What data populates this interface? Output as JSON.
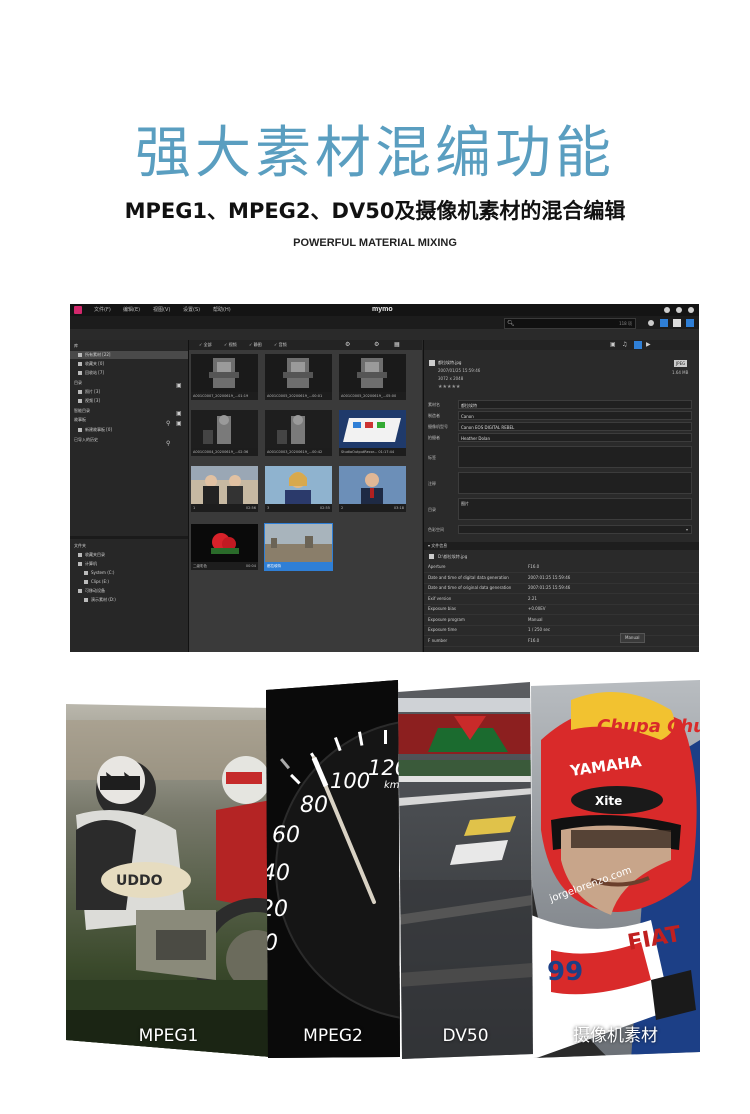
{
  "header": {
    "title": "强大素材混编功能",
    "subtitle": "MPEG1、MPEG2、DV50及摄像机素材的混合编辑",
    "tagline": "POWERFUL MATERIAL MIXING"
  },
  "app": {
    "name": "mymo",
    "menu": [
      "文件(F)",
      "编辑(E)",
      "视图(V)",
      "设置(S)",
      "帮助(H)"
    ],
    "search_count": "118 项",
    "left_tree": [
      {
        "label": "库",
        "sel": false
      },
      {
        "label": "所有素材 [22]",
        "sel": true
      },
      {
        "label": "收藏夹 [0]",
        "sel": false
      },
      {
        "label": "回收站 [7]",
        "sel": false
      },
      {
        "label": "目录",
        "sel": false
      },
      {
        "label": "照片 [3]",
        "sel": false
      },
      {
        "label": "视频 [3]",
        "sel": false
      },
      {
        "label": "智能目录",
        "sel": false
      },
      {
        "label": "故事板",
        "sel": false
      },
      {
        "label": "新建故事板 [0]",
        "sel": false
      },
      {
        "label": "已导入的历史",
        "sel": false
      }
    ],
    "folder_tree": [
      {
        "label": "文件夹"
      },
      {
        "label": "收藏夹目录"
      },
      {
        "label": "计算机"
      },
      {
        "label": "System (C:)"
      },
      {
        "label": "Clips (E:)"
      },
      {
        "label": "可移动设备"
      },
      {
        "label": "演示素材 (D:)"
      }
    ],
    "filters": [
      "全部",
      "视频",
      "静图",
      "音频"
    ],
    "thumbnails": [
      {
        "caption": "A001C0007_20200619_...01:19",
        "extra": "",
        "kind": "robot",
        "sel": false
      },
      {
        "caption": "A001C0005_20200619_...00:01",
        "extra": "",
        "kind": "robot",
        "sel": false
      },
      {
        "caption": "A001C0005_20200619_...05:00",
        "extra": "",
        "kind": "robot",
        "sel": false
      },
      {
        "caption": "A001C0004_20200619_...02:36",
        "extra": "",
        "kind": "robot2",
        "sel": false
      },
      {
        "caption": "A001C0003_20200619_...00:42",
        "extra": "",
        "kind": "robot2",
        "sel": false
      },
      {
        "caption": "StudioOutputRecor... 01:17:44",
        "extra": "",
        "kind": "board",
        "sel": false
      },
      {
        "caption": "1",
        "extra": "02:56",
        "kind": "people",
        "sel": false
      },
      {
        "caption": "3",
        "extra": "02:55",
        "kind": "woman",
        "sel": false
      },
      {
        "caption": "2",
        "extra": "03:18",
        "kind": "man",
        "sel": false
      },
      {
        "caption": "二级彩色",
        "extra": "00:04",
        "kind": "flower",
        "sel": false
      },
      {
        "caption": "都拉埃特",
        "extra": "",
        "kind": "city",
        "sel": true
      }
    ],
    "file_info": {
      "name": "都拉埃特.jpg",
      "date": "2007/01/25 15:59:46",
      "dims": "3072 x 2048",
      "size": "1.64 MB",
      "badge": "JPEG"
    },
    "meta_fields": [
      {
        "key": "素材名",
        "value": "都拉埃特"
      },
      {
        "key": "制造者",
        "value": "Canon"
      },
      {
        "key": "摄像机型号",
        "value": "Canon EOS DIGITAL REBEL"
      },
      {
        "key": "拍摄者",
        "value": "Heather Dolan"
      }
    ],
    "meta_tags": {
      "key": "标签",
      "value": ""
    },
    "meta_note": {
      "key": "注释",
      "value": ""
    },
    "meta_dir": {
      "key": "目录",
      "value": "图片"
    },
    "meta_space": {
      "key": "色彩空间",
      "value": ""
    },
    "file_section": "文件信息",
    "file_path": "D:\\都拉埃特.jpg",
    "exif": [
      {
        "k": "Aperture",
        "v": "F16.0"
      },
      {
        "k": "Date and time of digital data generation",
        "v": "2007:01:25 15:59:46"
      },
      {
        "k": "Date and time of original data generation",
        "v": "2007:01:25 15:59:46"
      },
      {
        "k": "Exif version",
        "v": "2.21"
      },
      {
        "k": "Exposure bias",
        "v": "+0.00EV"
      },
      {
        "k": "Exposure program",
        "v": "Manual"
      },
      {
        "k": "Exposure time",
        "v": "1 / 250 sec"
      },
      {
        "k": "F number",
        "v": "F16.0"
      }
    ],
    "exif_mode": "Manual"
  },
  "formats": [
    {
      "label": "MPEG1"
    },
    {
      "label": "MPEG2"
    },
    {
      "label": "DV50"
    },
    {
      "label": "摄像机素材"
    }
  ],
  "speedo": {
    "n100": "100",
    "n120": "120",
    "n80": "80",
    "n60": "60",
    "n40": "40",
    "n20": "20",
    "n0": "0",
    "unit": "km"
  },
  "helmet": {
    "brand": "Chupa Chups",
    "yamaha": "YAMAHA",
    "xite": "Xite",
    "site": "jorgelorenzo.com",
    "fiat": "FIAT",
    "number": "99"
  },
  "colors": {
    "title": "#5a9ec0",
    "accent": "#2f7fd6",
    "logo": "#d3286c"
  }
}
